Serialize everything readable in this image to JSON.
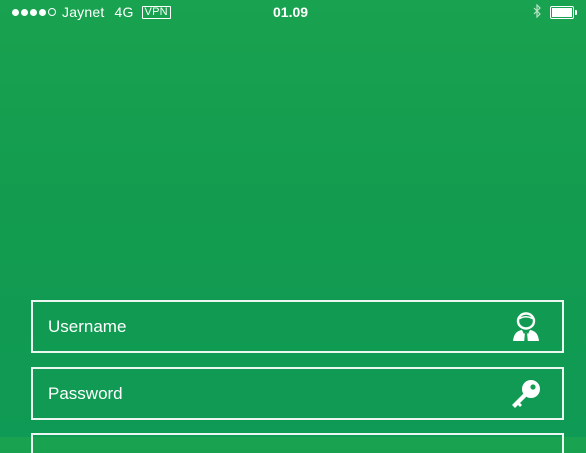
{
  "status_bar": {
    "carrier": "Jaynet",
    "network": "4G",
    "vpn": "VPN",
    "time": "01.09",
    "signal_strength": 4,
    "signal_max": 5,
    "battery_level": 1.0
  },
  "login": {
    "username_placeholder": "Username",
    "password_placeholder": "Password",
    "username_icon": "user-icon",
    "password_icon": "key-icon"
  },
  "colors": {
    "background_top": "#19a24f",
    "background_bottom": "#0f9a55",
    "foreground": "#ffffff"
  }
}
